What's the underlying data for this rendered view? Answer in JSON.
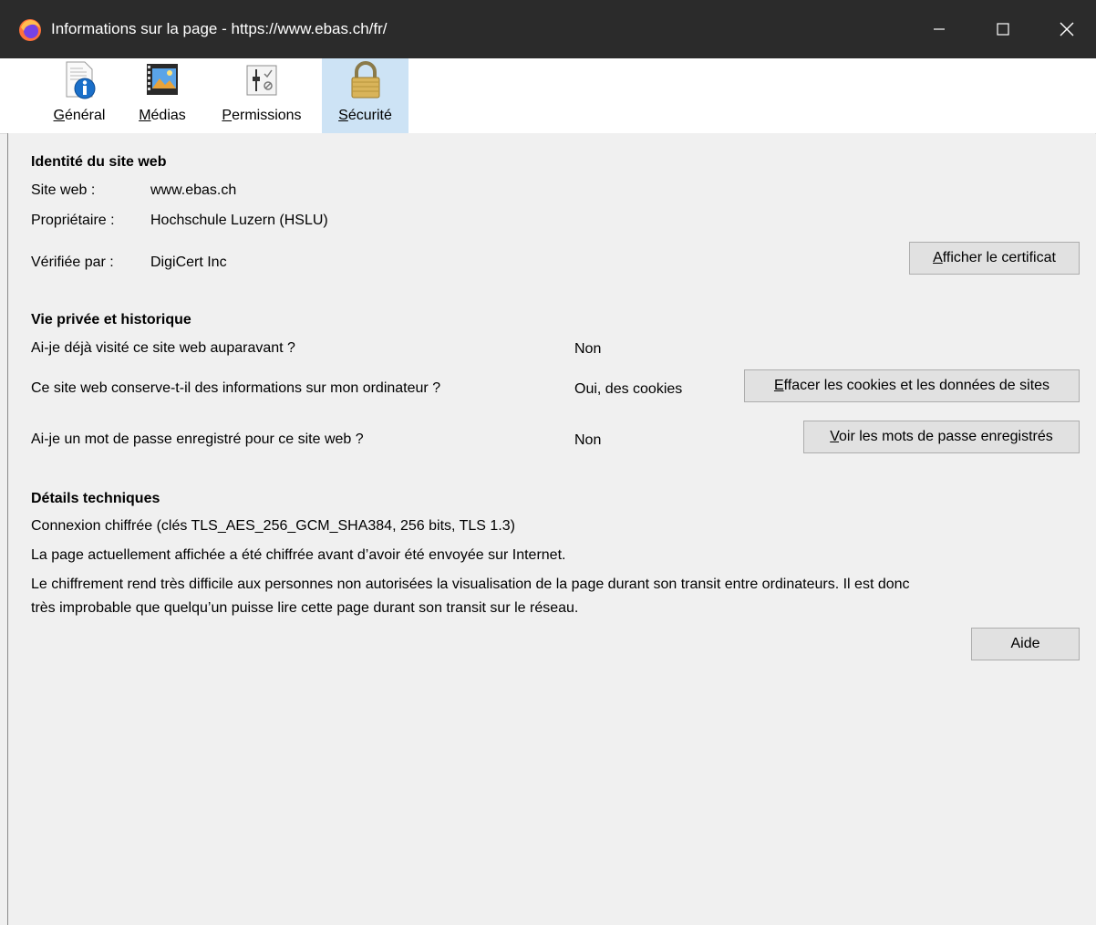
{
  "window": {
    "title": "Informations sur la page - https://www.ebas.ch/fr/",
    "icons": {
      "app": "firefox-logo-icon",
      "minimize": "minimize-icon",
      "maximize": "maximize-icon",
      "close": "close-icon"
    }
  },
  "tabs": [
    {
      "first": "G",
      "rest": "énéral",
      "icon": "info-document-icon"
    },
    {
      "first": "M",
      "rest": "édias",
      "icon": "media-film-icon"
    },
    {
      "first": "P",
      "rest": "ermissions",
      "icon": "permissions-sliders-icon"
    },
    {
      "first": "S",
      "rest": "écurité",
      "icon": "padlock-icon",
      "selected": true
    }
  ],
  "identity": {
    "heading": "Identité du site web",
    "website_label": "Site web :",
    "website_value": "www.ebas.ch",
    "owner_label": "Propriétaire :",
    "owner_value": "Hochschule Luzern (HSLU)",
    "verified_label": "Vérifiée par :",
    "verified_value": "DigiCert Inc",
    "cert_button_first": "A",
    "cert_button_rest": "fficher le certificat"
  },
  "privacy": {
    "heading": "Vie privée et historique",
    "q1": "Ai-je déjà visité ce site web auparavant ?",
    "a1": "Non",
    "q2": "Ce site web conserve-t-il des informations sur mon ordinateur ?",
    "a2": "Oui, des cookies",
    "clear_button_first": "E",
    "clear_button_rest": "ffacer les cookies et les données de sites",
    "q3": "Ai-je un mot de passe enregistré pour ce site web ?",
    "a3": "Non",
    "passwords_button_first": "V",
    "passwords_button_rest": "oir les mots de passe enregistrés"
  },
  "technical": {
    "heading": "Détails techniques",
    "line1": "Connexion chiffrée (clés TLS_AES_256_GCM_SHA384, 256 bits, TLS 1.3)",
    "line2": "La page actuellement affichée a été chiffrée avant d’avoir été envoyée sur Internet.",
    "line3": "Le chiffrement rend très difficile aux personnes non autorisées la visualisation de la page durant son transit entre ordinateurs. Il est donc",
    "line4": "très improbable que quelqu’un puisse lire cette page durant son transit sur le réseau."
  },
  "help_button": "Aide"
}
